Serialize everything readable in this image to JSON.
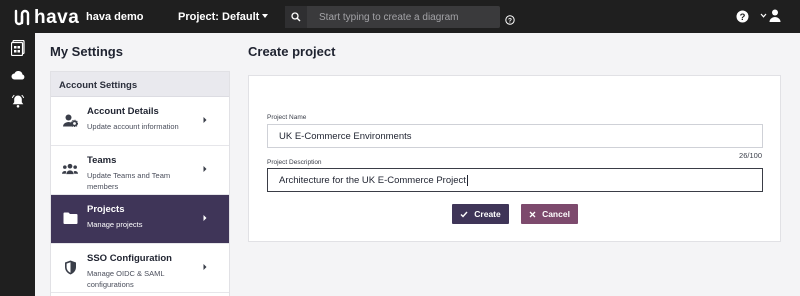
{
  "topbar": {
    "logo_text": "hava",
    "workspace": "hava demo",
    "project_selector": "Project: Default",
    "search": {
      "placeholder": "Start typing to create a diagram"
    },
    "colors": {
      "bar": "#1f1f1f",
      "search": "#3a3a3c"
    }
  },
  "rail": {
    "items": [
      {
        "icon": "diagrams-icon"
      },
      {
        "icon": "cloud-icon"
      },
      {
        "icon": "bell-icon"
      }
    ]
  },
  "settings": {
    "title": "My Settings",
    "section_header": "Account Settings",
    "items": [
      {
        "icon": "user-gear-icon",
        "title": "Account Details",
        "subtitle": "Update account information",
        "active": false
      },
      {
        "icon": "users-icon",
        "title": "Teams",
        "subtitle": "Update Teams and Team members",
        "active": false
      },
      {
        "icon": "folder-icon",
        "title": "Projects",
        "subtitle": "Manage projects",
        "active": true
      },
      {
        "icon": "shield-icon",
        "title": "SSO Configuration",
        "subtitle": "Manage OIDC & SAML configurations",
        "active": false
      }
    ],
    "colors": {
      "active": "#3f3558"
    }
  },
  "create_project": {
    "title": "Create project",
    "name_label": "Project Name",
    "name_value": "UK E-Commerce Environments",
    "name_counter": "26/100",
    "description_label": "Project Description",
    "description_value": "Architecture for the UK E-Commerce Project",
    "create_label": "Create",
    "cancel_label": "Cancel",
    "colors": {
      "create": "#3f3558",
      "cancel": "#7d4a6d"
    }
  }
}
